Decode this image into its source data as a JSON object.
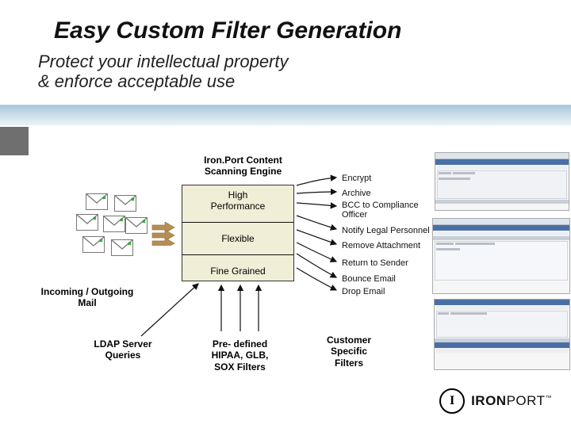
{
  "title": "Easy Custom Filter Generation",
  "subtitle_line1": "Protect your intellectual property",
  "subtitle_line2": "& enforce acceptable use",
  "engine_title_line1": "Iron.Port Content",
  "engine_title_line2": "Scanning Engine",
  "features": {
    "perf_line1": "High",
    "perf_line2": "Performance",
    "flexible": "Flexible",
    "fine_grained": "Fine Grained"
  },
  "mail_label_line1": "Incoming / Outgoing",
  "mail_label_line2": "Mail",
  "outputs": [
    "Encrypt",
    "Archive",
    "BCC to Compliance Officer",
    "Notify Legal Personnel",
    "Remove Attachment",
    "Return to Sender",
    "Bounce Email",
    "Drop Email"
  ],
  "bottom_inputs": {
    "ldap_line1": "LDAP Server",
    "ldap_line2": "Queries",
    "filters_line1": "Pre- defined",
    "filters_line2": "HIPAA, GLB,",
    "filters_line3": "SOX Filters",
    "cust_line1": "Customer",
    "cust_line2": "Specific",
    "cust_line3": "Filters"
  },
  "logo": {
    "glyph": "I",
    "text_iron": "IRON",
    "text_port": "PORT",
    "tm": "™"
  }
}
